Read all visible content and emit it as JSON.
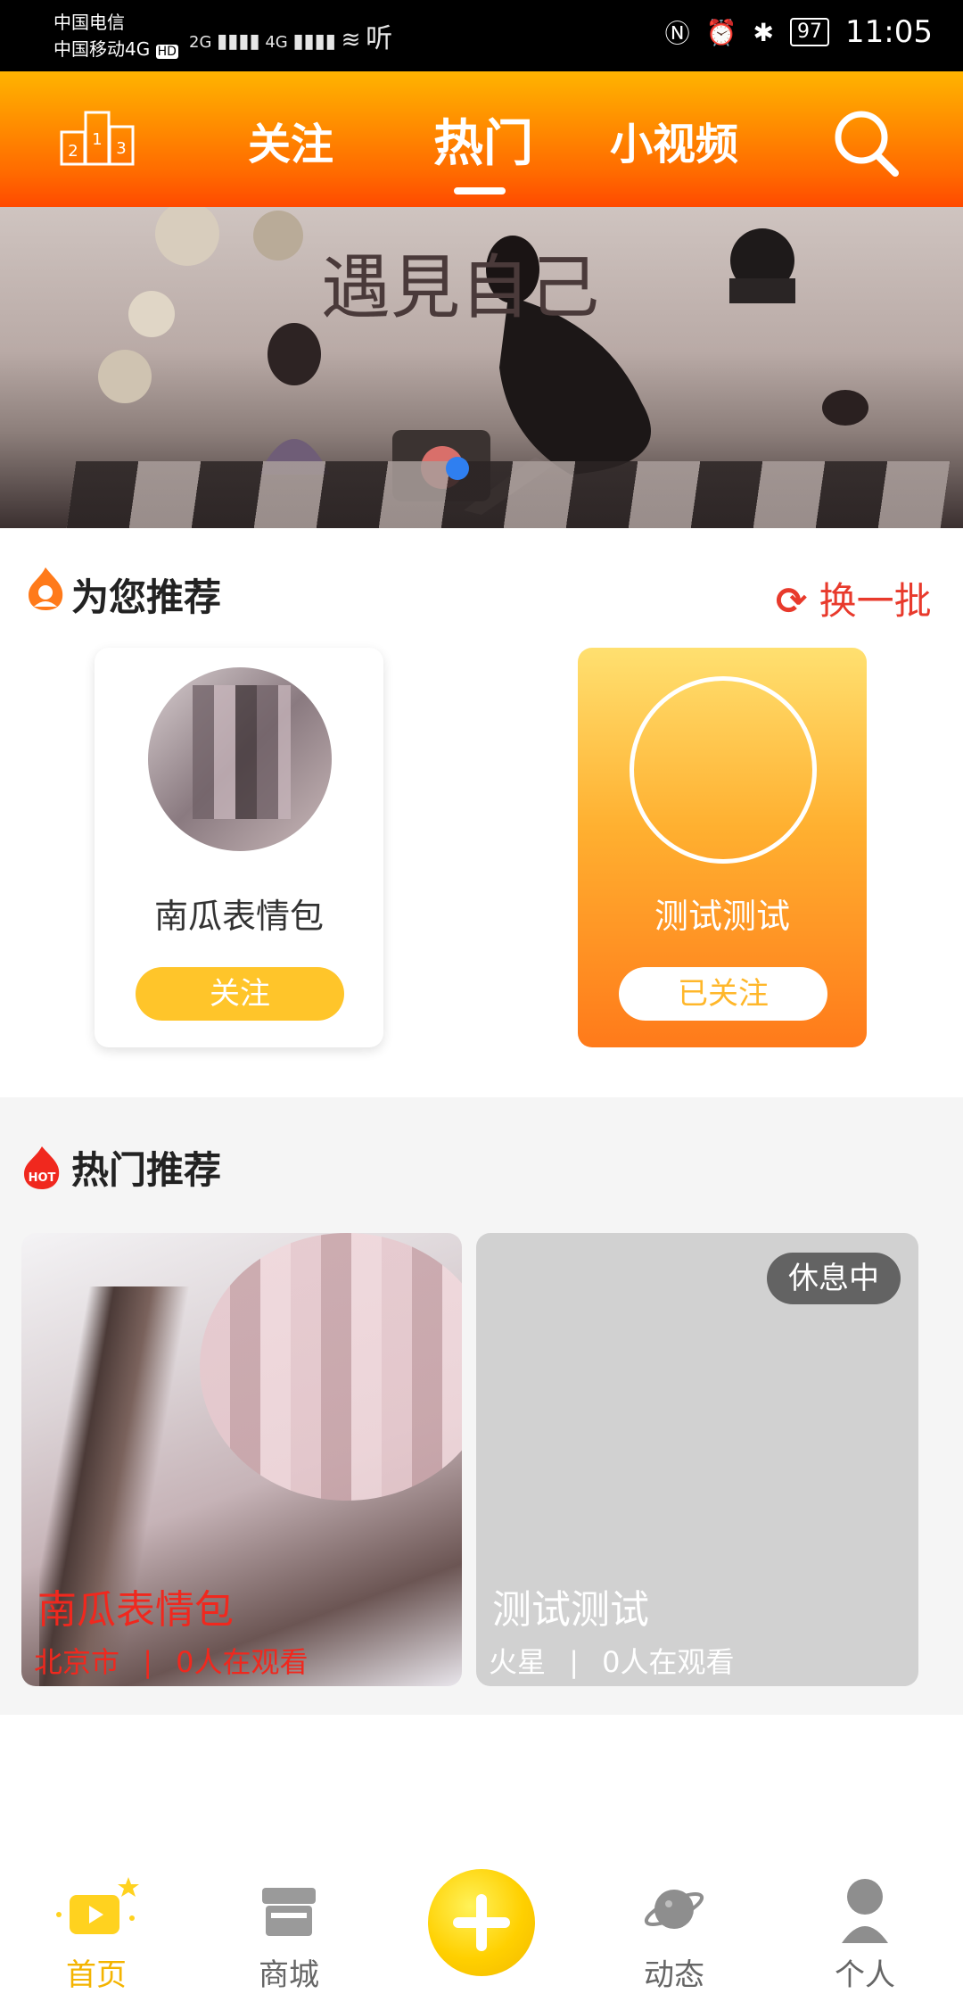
{
  "status_bar": {
    "carrier1": "中国电信",
    "carrier2": "中国移动4G",
    "hd": "HD",
    "net1": "2G",
    "net2": "4G",
    "listen": "听",
    "battery": "97",
    "time": "11:05"
  },
  "header": {
    "tabs": [
      {
        "label": "关注",
        "active": false
      },
      {
        "label": "热门",
        "active": true
      },
      {
        "label": "小视频",
        "active": false
      }
    ],
    "rank_numbers": [
      "2",
      "1",
      "3"
    ]
  },
  "banner": {
    "text": "遇見自己"
  },
  "recommend": {
    "title": "为您推荐",
    "refresh_label": "换一批",
    "cards": [
      {
        "name": "南瓜表情包",
        "button": "关注",
        "followed": false
      },
      {
        "name": "测试测试",
        "button": "已关注",
        "followed": true
      }
    ]
  },
  "hot": {
    "title": "热门推荐",
    "hot_badge": "HOT",
    "items": [
      {
        "name": "南瓜表情包",
        "location": "北京市",
        "separator": "|",
        "viewers": "0人在观看",
        "status": ""
      },
      {
        "name": "测试测试",
        "location": "火星",
        "separator": "|",
        "viewers": "0人在观看",
        "status": "休息中"
      }
    ]
  },
  "bottom_nav": {
    "items": [
      {
        "label": "首页",
        "active": true
      },
      {
        "label": "商城",
        "active": false
      },
      {
        "label": "动态",
        "active": false
      },
      {
        "label": "个人",
        "active": false
      }
    ]
  },
  "colors": {
    "accent_orange": "#ff6a00",
    "accent_yellow": "#ffc52a",
    "red_text": "#e83a2c",
    "live_red": "#f0281e"
  }
}
